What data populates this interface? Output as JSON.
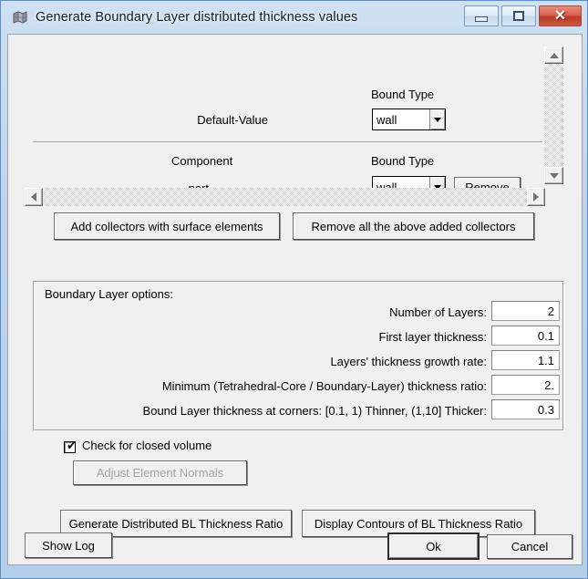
{
  "window": {
    "title": "Generate Boundary Layer distributed thickness values",
    "icon": "mesh-grid-icon",
    "controls": {
      "minimize": "minimize-icon",
      "maximize": "maximize-icon",
      "close": "✕"
    }
  },
  "default_row": {
    "bound_type_header": "Bound Type",
    "name_label": "Default-Value",
    "bound_type_value": "wall"
  },
  "component_row": {
    "component_header": "Component",
    "bound_type_header": "Bound Type",
    "name_label": "part",
    "bound_type_value": "wall",
    "remove_label": "Remove"
  },
  "collector_buttons": {
    "add_label": "Add collectors with surface elements",
    "remove_all_label": "Remove all the above added collectors"
  },
  "bl_options": {
    "legend": "Boundary Layer options:",
    "fields": [
      {
        "label": "Number of Layers:",
        "value": "2"
      },
      {
        "label": "First layer thickness:",
        "value": "0.1"
      },
      {
        "label": "Layers' thickness growth rate:",
        "value": "1.1"
      },
      {
        "label": "Minimum (Tetrahedral-Core / Boundary-Layer) thickness ratio:",
        "value": "2."
      },
      {
        "label": "Bound Layer thickness at corners: [0.1, 1) Thinner, (1,10] Thicker:",
        "value": "0.3"
      }
    ]
  },
  "closed_volume": {
    "label": "Check for closed volume",
    "checked": "✔"
  },
  "adjust_normals": {
    "label": "Adjust Element Normals",
    "enabled": false
  },
  "action_buttons": {
    "generate_label": "Generate Distributed BL Thickness Ratio",
    "display_label": "Display Contours of BL Thickness Ratio"
  },
  "footer": {
    "show_log_label": "Show Log",
    "ok_label": "Ok",
    "cancel_label": "Cancel"
  },
  "colors": {
    "frame": "#b4cee9",
    "client": "#f0f0f0",
    "close_button": "#c04a33",
    "field_bg": "#ffffff"
  }
}
